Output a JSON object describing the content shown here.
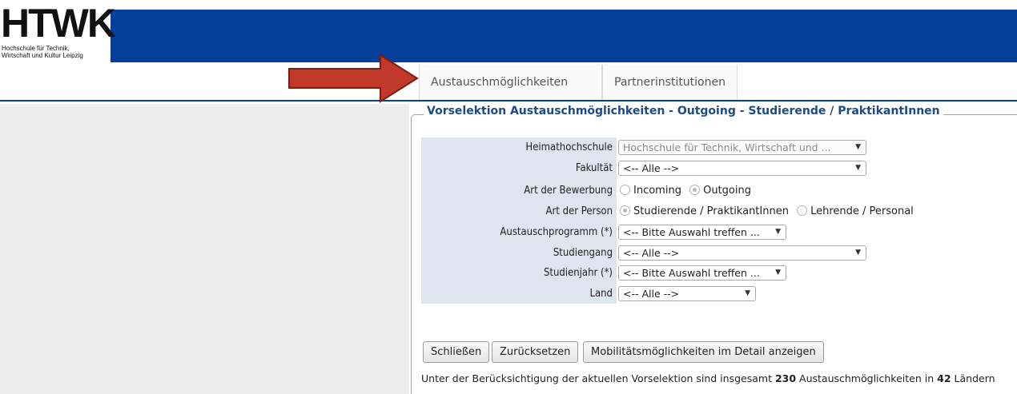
{
  "logo": {
    "text": "HTWK",
    "subtitle": "Hochschule für Technik,\nWirtschaft und Kultur Leipzig"
  },
  "nav": {
    "tabs": [
      {
        "label": "Austauschmöglichkeiten"
      },
      {
        "label": "Partnerinstitutionen"
      }
    ]
  },
  "annotation": {
    "arrow_color": "#c0392b"
  },
  "form": {
    "legend": "Vorselektion Austauschmöglichkeiten - Outgoing - Studierende / PraktikantInnen",
    "fields": {
      "heimathochschule": {
        "label": "Heimathochschule",
        "value": "Hochschule für Technik, Wirtschaft und  ..."
      },
      "fakultaet": {
        "label": "Fakultät",
        "value": "<-- Alle -->"
      },
      "art_bewerbung": {
        "label": "Art der Bewerbung",
        "options": [
          "Incoming",
          "Outgoing"
        ],
        "selected": "Outgoing"
      },
      "art_person": {
        "label": "Art der Person",
        "options": [
          "Studierende / PraktikantInnen",
          "Lehrende / Personal"
        ],
        "selected": "Studierende / PraktikantInnen"
      },
      "austauschprogramm": {
        "label": "Austauschprogramm (*)",
        "value": "<-- Bitte Auswahl treffen ..."
      },
      "studiengang": {
        "label": "Studiengang",
        "value": "<-- Alle -->"
      },
      "studienjahr": {
        "label": "Studienjahr (*)",
        "value": "<-- Bitte Auswahl treffen ..."
      },
      "land": {
        "label": "Land",
        "value": "<-- Alle -->"
      }
    },
    "buttons": {
      "close": "Schließen",
      "reset": "Zurücksetzen",
      "details": "Mobilitätsmöglichkeiten im Detail anzeigen"
    },
    "summary": {
      "prefix": "Unter der Berücksichtigung der aktuellen Vorselektion sind insgesamt",
      "count": "230",
      "middle": "Austauschmöglichkeiten in",
      "countries": "42",
      "suffix": "Ländern"
    }
  },
  "colors": {
    "header_blue": "#04409a",
    "legend_text": "#1d4a86",
    "label_bg": "#dfe5ee",
    "left_panel": "#eeeeee"
  }
}
